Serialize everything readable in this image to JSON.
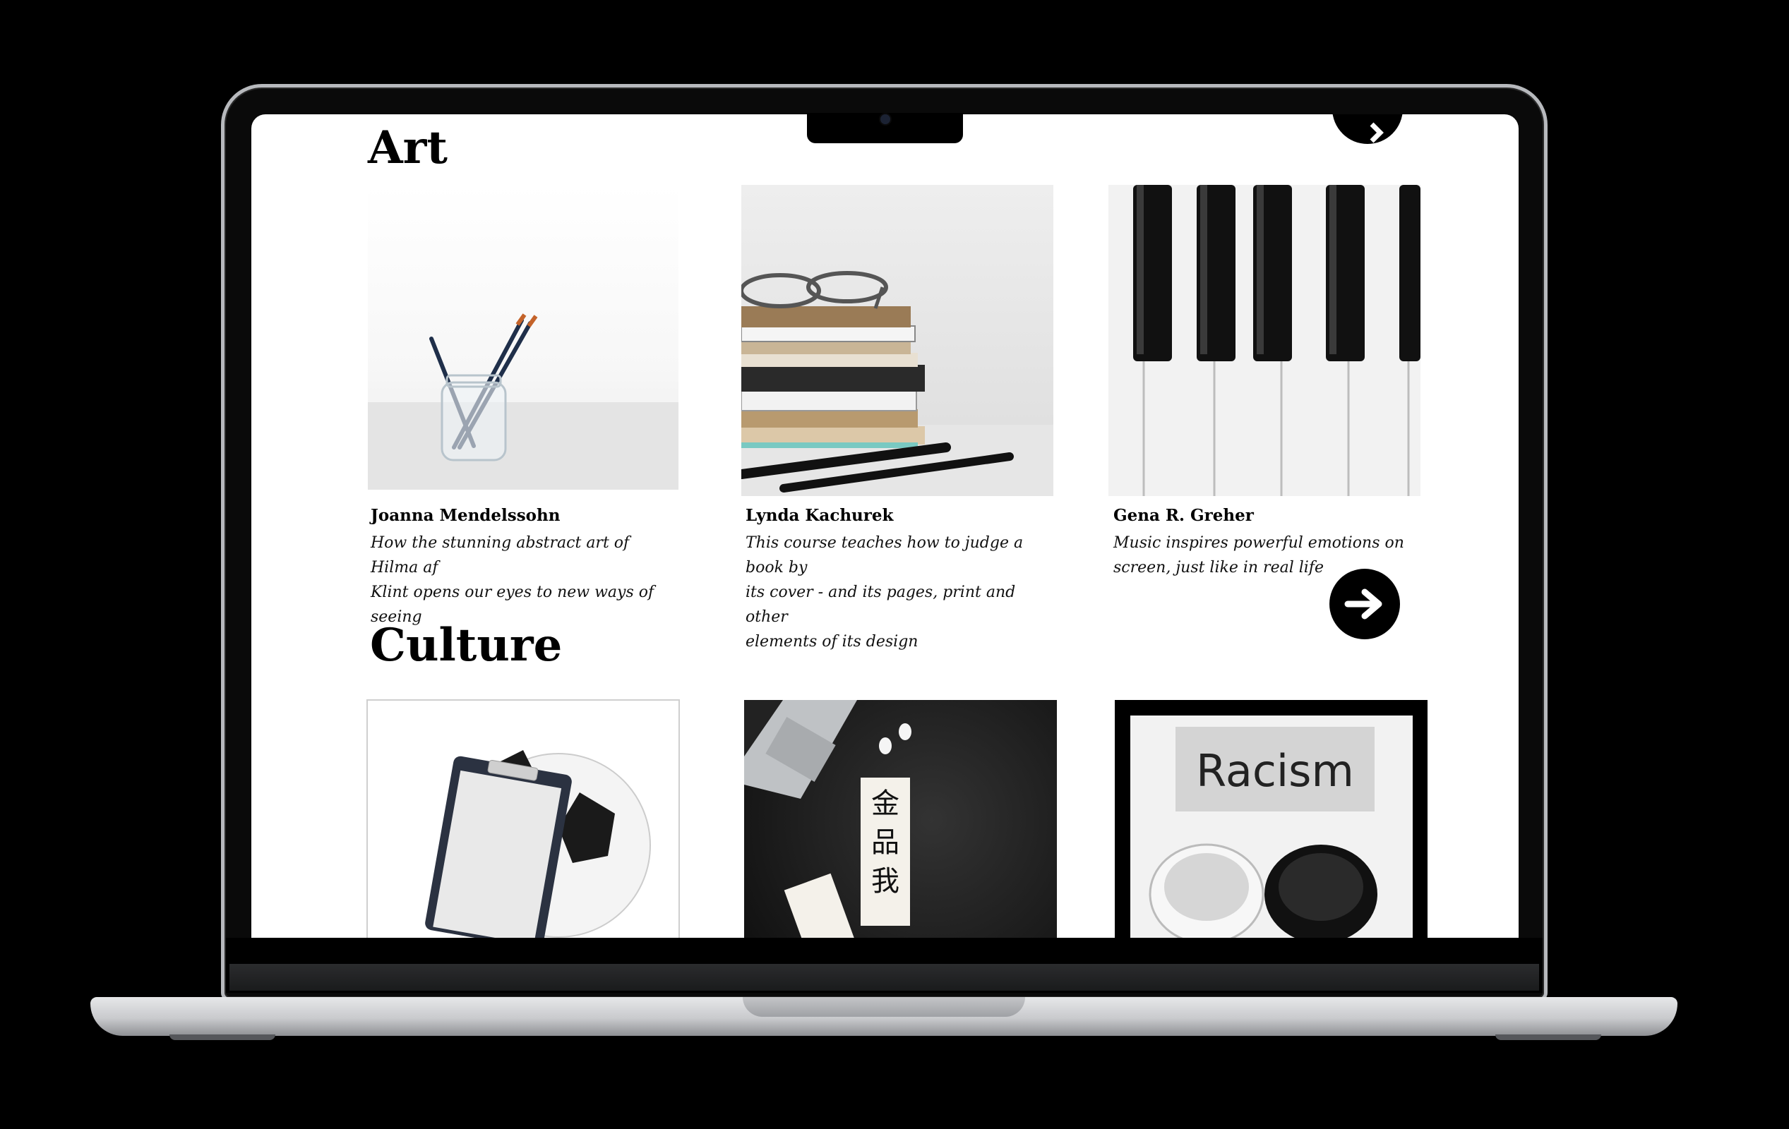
{
  "sections": [
    {
      "title": "Art",
      "cards": [
        {
          "author": "Joanna Mendelssohn",
          "line1": "How the stunning abstract art of Hilma af",
          "line2": "Klint opens our eyes to new ways of seeing",
          "line3": ""
        },
        {
          "author": "Lynda Kachurek",
          "line1": "This course teaches how to judge a book by",
          "line2": "its cover - and its pages, print and other",
          "line3": "elements of its design"
        },
        {
          "author": "Gena R. Greher",
          "line1": "Music inspires powerful emotions on",
          "line2": "screen, just like in real life",
          "line3": ""
        }
      ]
    },
    {
      "title": "Culture",
      "cards": [
        {
          "image_text": ""
        },
        {
          "image_text": "金品我"
        },
        {
          "image_text": "Racism"
        }
      ]
    }
  ],
  "icons": {
    "next": "arrow-right-icon"
  },
  "colors": {
    "background": "#000000",
    "screen": "#ffffff",
    "accent": "#000000"
  }
}
